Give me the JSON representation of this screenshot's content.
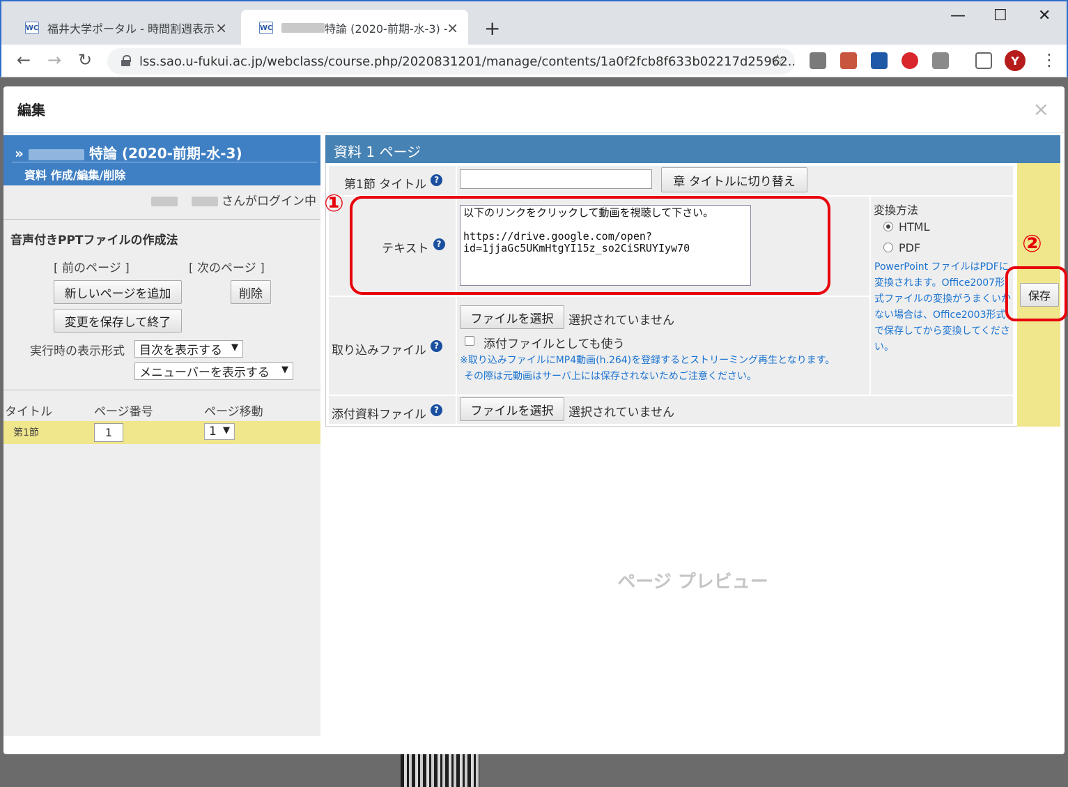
{
  "browser": {
    "tabs": [
      {
        "title": "福井大学ポータル - 時間割週表示",
        "favicon": "WC"
      },
      {
        "title": "特論 (2020-前期-水-3) -",
        "favicon": "WC"
      }
    ],
    "url": "lss.sao.u-fukui.ac.jp/webclass/course.php/2020831201/manage/contents/1a0f2fcb8f633b02217d25962...",
    "avatar_letter": "Y"
  },
  "modal": {
    "title": "編集",
    "close": "×"
  },
  "left": {
    "course_title": "特論 (2020-前期-水-3)",
    "course_sub": "資料 作成/編集/削除",
    "login_text": "さんがログイン中",
    "ppt_title": "音声付きPPTファイルの作成法",
    "prev_page": "[ 前のページ ]",
    "next_page": "[ 次のページ ]",
    "add_page_button": "新しいページを追加",
    "delete_button": "削除",
    "save_exit_button": "変更を保存して終了",
    "display_format_label": "実行時の表示形式",
    "toc_select": "目次を表示する",
    "menubar_select": "メニューバーを表示する",
    "table": {
      "headers": [
        "タイトル",
        "ページ番号",
        "ページ移動"
      ],
      "row": {
        "title": "第1節",
        "page_number": "1",
        "page_move": "1"
      }
    }
  },
  "right": {
    "header": "資料 1 ページ",
    "section_title_label": "第1節 タイトル",
    "section_title_value": "",
    "switch_chapter_button": "章 タイトルに切り替え",
    "text_label": "テキスト",
    "text_value": "以下のリンクをクリックして動画を視聴して下さい。\n\nhttps://drive.google.com/open?id=1jjaGc5UKmHtgYI15z_so2CiSRUYIyw70",
    "convert_label": "変換方法",
    "convert_html": "HTML",
    "convert_pdf": "PDF",
    "convert_note": "PowerPoint ファイルはPDFに変換されます。Office2007形式ファイルの変換がうまくいかない場合は、Office2003形式で保存してから変換してください。",
    "import_label": "取り込みファイル",
    "choose_file_button": "ファイルを選択",
    "no_file_selected": "選択されていません",
    "use_as_attachment": "添付ファイルとしても使う",
    "import_note_1": "※取り込みファイルにMP4動画(h.264)を登録するとストリーミング再生となります。",
    "import_note_2": "その際は元動画はサーバ上には保存されないためご注意ください。",
    "attach_label": "添付資料ファイル",
    "attach_choose_button": "ファイルを選択",
    "attach_no_file": "選択されていません",
    "save_button": "保存",
    "preview_text": "ページ プレビュー"
  },
  "annotations": {
    "marker_1": "①",
    "marker_2": "②",
    "color": "#e8000b"
  }
}
